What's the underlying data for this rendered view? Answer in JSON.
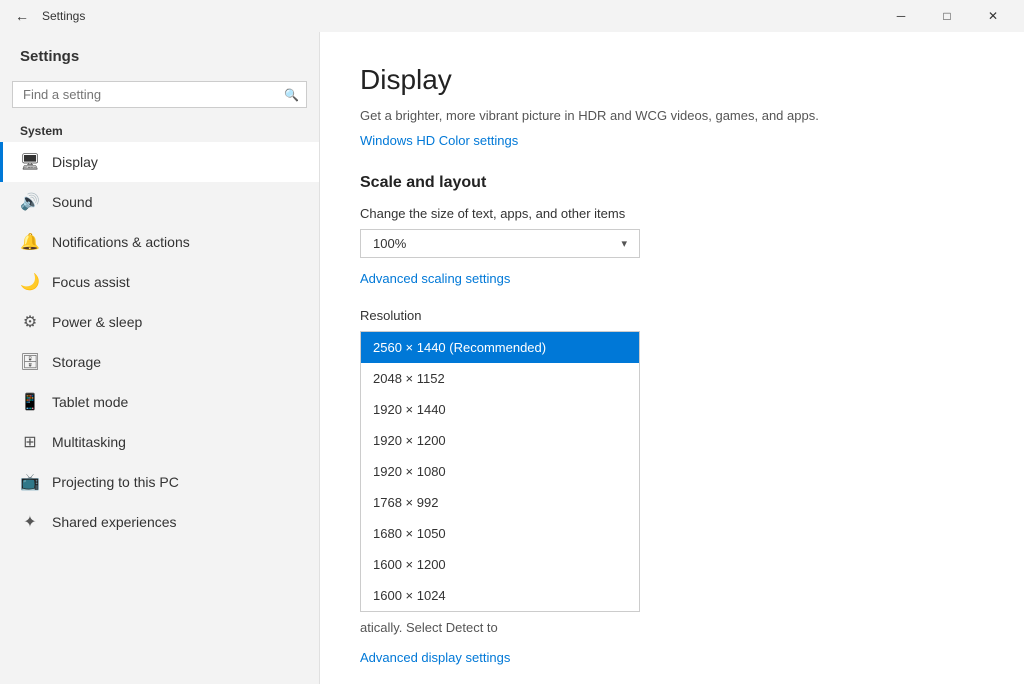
{
  "titlebar": {
    "title": "Settings",
    "back_label": "←",
    "minimize_label": "─",
    "maximize_label": "□",
    "close_label": "✕"
  },
  "sidebar": {
    "app_title": "Settings",
    "search_placeholder": "Find a setting",
    "section_label": "System",
    "nav_items": [
      {
        "id": "display",
        "icon": "🖥",
        "label": "Display",
        "active": true
      },
      {
        "id": "sound",
        "icon": "🔊",
        "label": "Sound",
        "active": false
      },
      {
        "id": "notifications",
        "icon": "🔔",
        "label": "Notifications & actions",
        "active": false
      },
      {
        "id": "focus",
        "icon": "🌙",
        "label": "Focus assist",
        "active": false
      },
      {
        "id": "power",
        "icon": "⚙",
        "label": "Power & sleep",
        "active": false
      },
      {
        "id": "storage",
        "icon": "🗄",
        "label": "Storage",
        "active": false
      },
      {
        "id": "tablet",
        "icon": "📱",
        "label": "Tablet mode",
        "active": false
      },
      {
        "id": "multitasking",
        "icon": "⊞",
        "label": "Multitasking",
        "active": false
      },
      {
        "id": "projecting",
        "icon": "📺",
        "label": "Projecting to this PC",
        "active": false
      },
      {
        "id": "shared",
        "icon": "✦",
        "label": "Shared experiences",
        "active": false
      }
    ]
  },
  "content": {
    "page_title": "Display",
    "description": "Get a brighter, more vibrant picture in HDR and WCG videos, games, and apps.",
    "hdr_link": "Windows HD Color settings",
    "scale_section_title": "Scale and layout",
    "scale_field_label": "Change the size of text, apps, and other items",
    "scale_value": "100%",
    "advanced_scaling_link": "Advanced scaling settings",
    "resolution_label": "Resolution",
    "resolution_items": [
      {
        "value": "2560 × 1440 (Recommended)",
        "selected": true
      },
      {
        "value": "2048 × 1152",
        "selected": false
      },
      {
        "value": "1920 × 1440",
        "selected": false
      },
      {
        "value": "1920 × 1200",
        "selected": false
      },
      {
        "value": "1920 × 1080",
        "selected": false
      },
      {
        "value": "1768 × 992",
        "selected": false
      },
      {
        "value": "1680 × 1050",
        "selected": false
      },
      {
        "value": "1600 × 1200",
        "selected": false
      },
      {
        "value": "1600 × 1024",
        "selected": false
      }
    ],
    "partial_text": "atically. Select Detect to",
    "advanced_display_link": "Advanced display settings"
  }
}
